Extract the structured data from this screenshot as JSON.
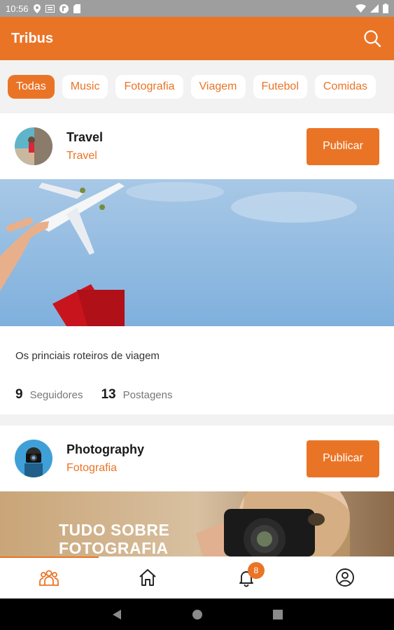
{
  "status_bar": {
    "time": "10:56"
  },
  "app": {
    "title": "Tribus"
  },
  "chips": [
    {
      "label": "Todas",
      "active": true
    },
    {
      "label": "Music",
      "active": false
    },
    {
      "label": "Fotografia",
      "active": false
    },
    {
      "label": "Viagem",
      "active": false
    },
    {
      "label": "Futebol",
      "active": false
    },
    {
      "label": "Comidas",
      "active": false
    }
  ],
  "cards": [
    {
      "title": "Travel",
      "subtitle": "Travel",
      "publish_label": "Publicar",
      "description": "Os princiais roteiros de viagem",
      "followers_count": "9",
      "followers_label": "Seguidores",
      "posts_count": "13",
      "posts_label": "Postagens"
    },
    {
      "title": "Photography",
      "subtitle": "Fotografia",
      "publish_label": "Publicar",
      "banner_text_line1": "TUDO SOBRE",
      "banner_text_line2": "FOTOGRAFIA"
    }
  ],
  "bottom_nav": {
    "items": [
      {
        "icon": "tribes-icon",
        "active": true
      },
      {
        "icon": "home-icon",
        "active": false
      },
      {
        "icon": "bell-icon",
        "active": false,
        "badge": "8"
      },
      {
        "icon": "profile-icon",
        "active": false
      }
    ]
  },
  "colors": {
    "accent": "#ea7426",
    "status_bar": "#9e9e9e"
  }
}
